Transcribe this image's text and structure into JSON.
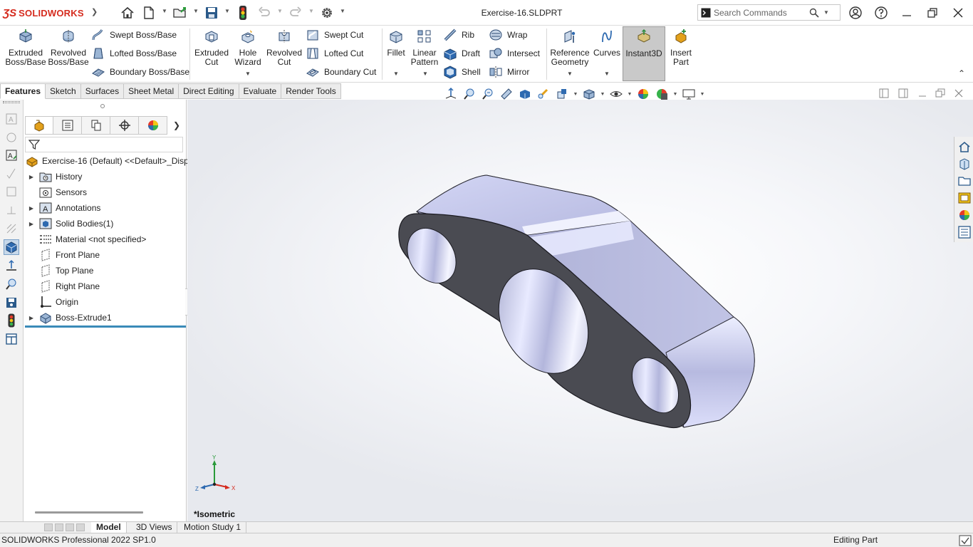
{
  "app": {
    "logo_text": "SOLIDWORKS",
    "document_title": "Exercise-16.SLDPRT"
  },
  "search": {
    "placeholder": "Search Commands"
  },
  "ribbon": {
    "extruded_boss": [
      "Extruded",
      "Boss/Base"
    ],
    "revolved_boss": [
      "Revolved",
      "Boss/Base"
    ],
    "swept_boss": "Swept Boss/Base",
    "lofted_boss": "Lofted Boss/Base",
    "boundary_boss": "Boundary Boss/Base",
    "extruded_cut": [
      "Extruded",
      "Cut"
    ],
    "hole_wizard": [
      "Hole",
      "Wizard"
    ],
    "revolved_cut": [
      "Revolved",
      "Cut"
    ],
    "swept_cut": "Swept Cut",
    "lofted_cut": "Lofted Cut",
    "boundary_cut": "Boundary Cut",
    "fillet": "Fillet",
    "linear_pattern": [
      "Linear",
      "Pattern"
    ],
    "rib": "Rib",
    "draft": "Draft",
    "shell": "Shell",
    "wrap": "Wrap",
    "intersect": "Intersect",
    "mirror": "Mirror",
    "reference_geometry": [
      "Reference",
      "Geometry"
    ],
    "curves": "Curves",
    "instant3d": "Instant3D",
    "insert_part": [
      "Insert",
      "Part"
    ]
  },
  "cm_tabs": [
    "Features",
    "Sketch",
    "Surfaces",
    "Sheet Metal",
    "Direct Editing",
    "Evaluate",
    "Render Tools"
  ],
  "feature_tree": {
    "root": "Exercise-16 (Default) <<Default>_Disp",
    "items": [
      {
        "label": "History",
        "expandable": true
      },
      {
        "label": "Sensors",
        "expandable": false
      },
      {
        "label": "Annotations",
        "expandable": true
      },
      {
        "label": "Solid Bodies(1)",
        "expandable": true
      },
      {
        "label": "Material <not specified>",
        "expandable": false
      },
      {
        "label": "Front Plane",
        "expandable": false
      },
      {
        "label": "Top Plane",
        "expandable": false
      },
      {
        "label": "Right Plane",
        "expandable": false
      },
      {
        "label": "Origin",
        "expandable": false
      },
      {
        "label": "Boss-Extrude1",
        "expandable": true
      }
    ]
  },
  "viewport": {
    "view_label": "*Isometric",
    "triad": {
      "x": "X",
      "y": "Y",
      "z": "Z"
    }
  },
  "bottom_tabs": [
    "Model",
    "3D Views",
    "Motion Study 1"
  ],
  "status": {
    "left": "SOLIDWORKS Professional 2022 SP1.0",
    "right": "Editing Part"
  },
  "colors": {
    "brand": "#d52b1e",
    "accent": "#3a8ab8",
    "part_face": "#4a4b52",
    "part_side": "#bcbfe0"
  }
}
